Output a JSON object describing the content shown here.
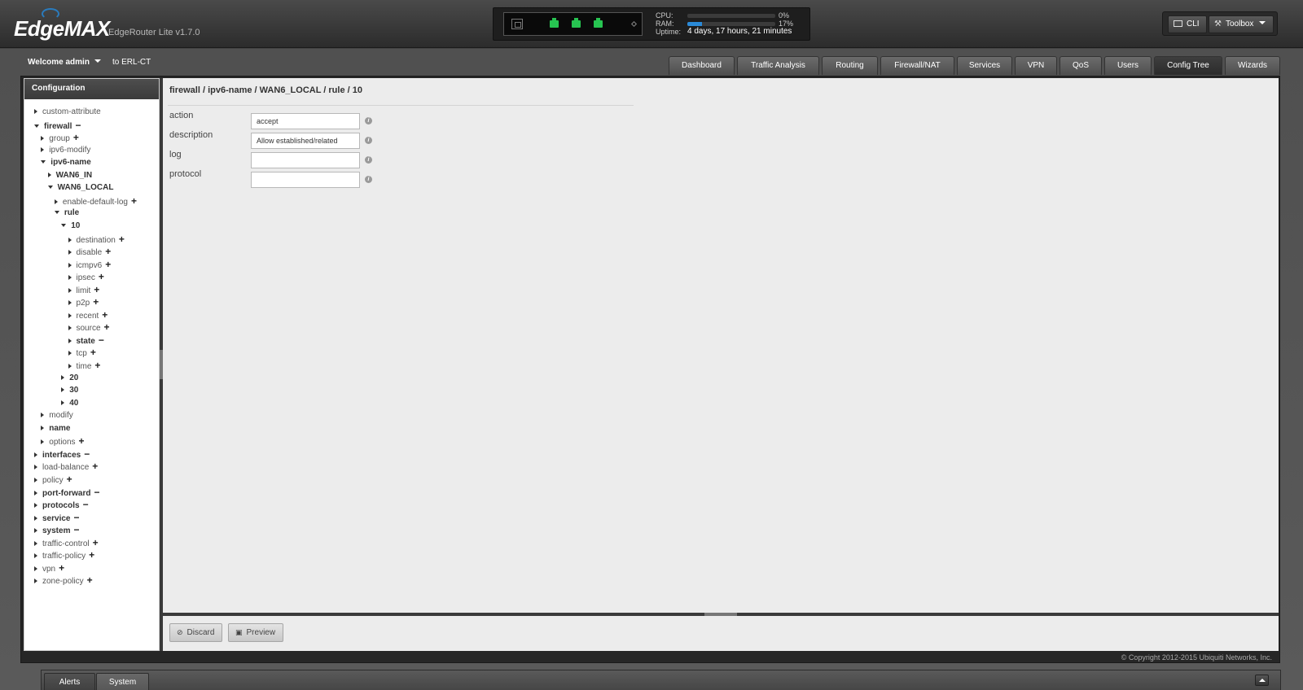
{
  "header": {
    "logo": "EdgeMAX",
    "product": "EdgeRouter Lite v1.7.0",
    "cpu_label": "CPU:",
    "cpu_value": "0%",
    "cpu_fraction": 0.0,
    "ram_label": "RAM:",
    "ram_value": "17%",
    "ram_fraction": 0.17,
    "uptime_label": "Uptime:",
    "uptime_value": "4 days, 17 hours, 21 minutes",
    "cli_label": "CLI",
    "toolbox_label": "Toolbox"
  },
  "user": {
    "welcome": "Welcome admin",
    "host": "to ERL-CT"
  },
  "tabs": [
    "Dashboard",
    "Traffic Analysis",
    "Routing",
    "Firewall/NAT",
    "Services",
    "VPN",
    "QoS",
    "Users",
    "Config Tree",
    "Wizards"
  ],
  "active_tab": "Config Tree",
  "sidebar": {
    "title": "Configuration",
    "tree": [
      {
        "label": "custom-attribute",
        "bold": false,
        "open": false,
        "action": ""
      },
      {
        "label": "firewall",
        "bold": true,
        "open": true,
        "action": "−"
      },
      {
        "label": "group",
        "bold": false,
        "open": false,
        "action": "+"
      },
      {
        "label": "ipv6-modify",
        "bold": false,
        "open": false,
        "action": ""
      },
      {
        "label": "ipv6-name",
        "bold": true,
        "open": true,
        "action": ""
      },
      {
        "label": "WAN6_IN",
        "bold": true,
        "open": false,
        "action": ""
      },
      {
        "label": "WAN6_LOCAL",
        "bold": true,
        "open": true,
        "action": ""
      },
      {
        "label": "enable-default-log",
        "bold": false,
        "open": false,
        "action": "+"
      },
      {
        "label": "rule",
        "bold": true,
        "open": true,
        "action": ""
      },
      {
        "label": "10",
        "bold": true,
        "open": true,
        "action": ""
      },
      {
        "label": "destination",
        "bold": false,
        "open": false,
        "action": "+"
      },
      {
        "label": "disable",
        "bold": false,
        "open": false,
        "action": "+"
      },
      {
        "label": "icmpv6",
        "bold": false,
        "open": false,
        "action": "+"
      },
      {
        "label": "ipsec",
        "bold": false,
        "open": false,
        "action": "+"
      },
      {
        "label": "limit",
        "bold": false,
        "open": false,
        "action": "+"
      },
      {
        "label": "p2p",
        "bold": false,
        "open": false,
        "action": "+"
      },
      {
        "label": "recent",
        "bold": false,
        "open": false,
        "action": "+"
      },
      {
        "label": "source",
        "bold": false,
        "open": false,
        "action": "+"
      },
      {
        "label": "state",
        "bold": true,
        "open": false,
        "action": "−"
      },
      {
        "label": "tcp",
        "bold": false,
        "open": false,
        "action": "+"
      },
      {
        "label": "time",
        "bold": false,
        "open": false,
        "action": "+"
      },
      {
        "label": "20",
        "bold": true,
        "open": false,
        "action": ""
      },
      {
        "label": "30",
        "bold": true,
        "open": false,
        "action": ""
      },
      {
        "label": "40",
        "bold": true,
        "open": false,
        "action": ""
      },
      {
        "label": "modify",
        "bold": false,
        "open": false,
        "action": ""
      },
      {
        "label": "name",
        "bold": true,
        "open": false,
        "action": ""
      },
      {
        "label": "options",
        "bold": false,
        "open": false,
        "action": "+"
      },
      {
        "label": "interfaces",
        "bold": true,
        "open": false,
        "action": "−"
      },
      {
        "label": "load-balance",
        "bold": false,
        "open": false,
        "action": "+"
      },
      {
        "label": "policy",
        "bold": false,
        "open": false,
        "action": "+"
      },
      {
        "label": "port-forward",
        "bold": true,
        "open": false,
        "action": "−"
      },
      {
        "label": "protocols",
        "bold": true,
        "open": false,
        "action": "−"
      },
      {
        "label": "service",
        "bold": true,
        "open": false,
        "action": "−"
      },
      {
        "label": "system",
        "bold": true,
        "open": false,
        "action": "−"
      },
      {
        "label": "traffic-control",
        "bold": false,
        "open": false,
        "action": "+"
      },
      {
        "label": "traffic-policy",
        "bold": false,
        "open": false,
        "action": "+"
      },
      {
        "label": "vpn",
        "bold": false,
        "open": false,
        "action": "+"
      },
      {
        "label": "zone-policy",
        "bold": false,
        "open": false,
        "action": "+"
      }
    ]
  },
  "main": {
    "breadcrumb": "firewall / ipv6-name / WAN6_LOCAL / rule / 10",
    "fields": [
      {
        "label": "action",
        "value": "accept"
      },
      {
        "label": "description",
        "value": "Allow established/related"
      },
      {
        "label": "log",
        "value": ""
      },
      {
        "label": "protocol",
        "value": ""
      }
    ],
    "discard_label": "Discard",
    "preview_label": "Preview"
  },
  "copyright": "© Copyright 2012-2015 Ubiquiti Networks, Inc.",
  "drawer": {
    "alerts_label": "Alerts",
    "system_label": "System"
  }
}
